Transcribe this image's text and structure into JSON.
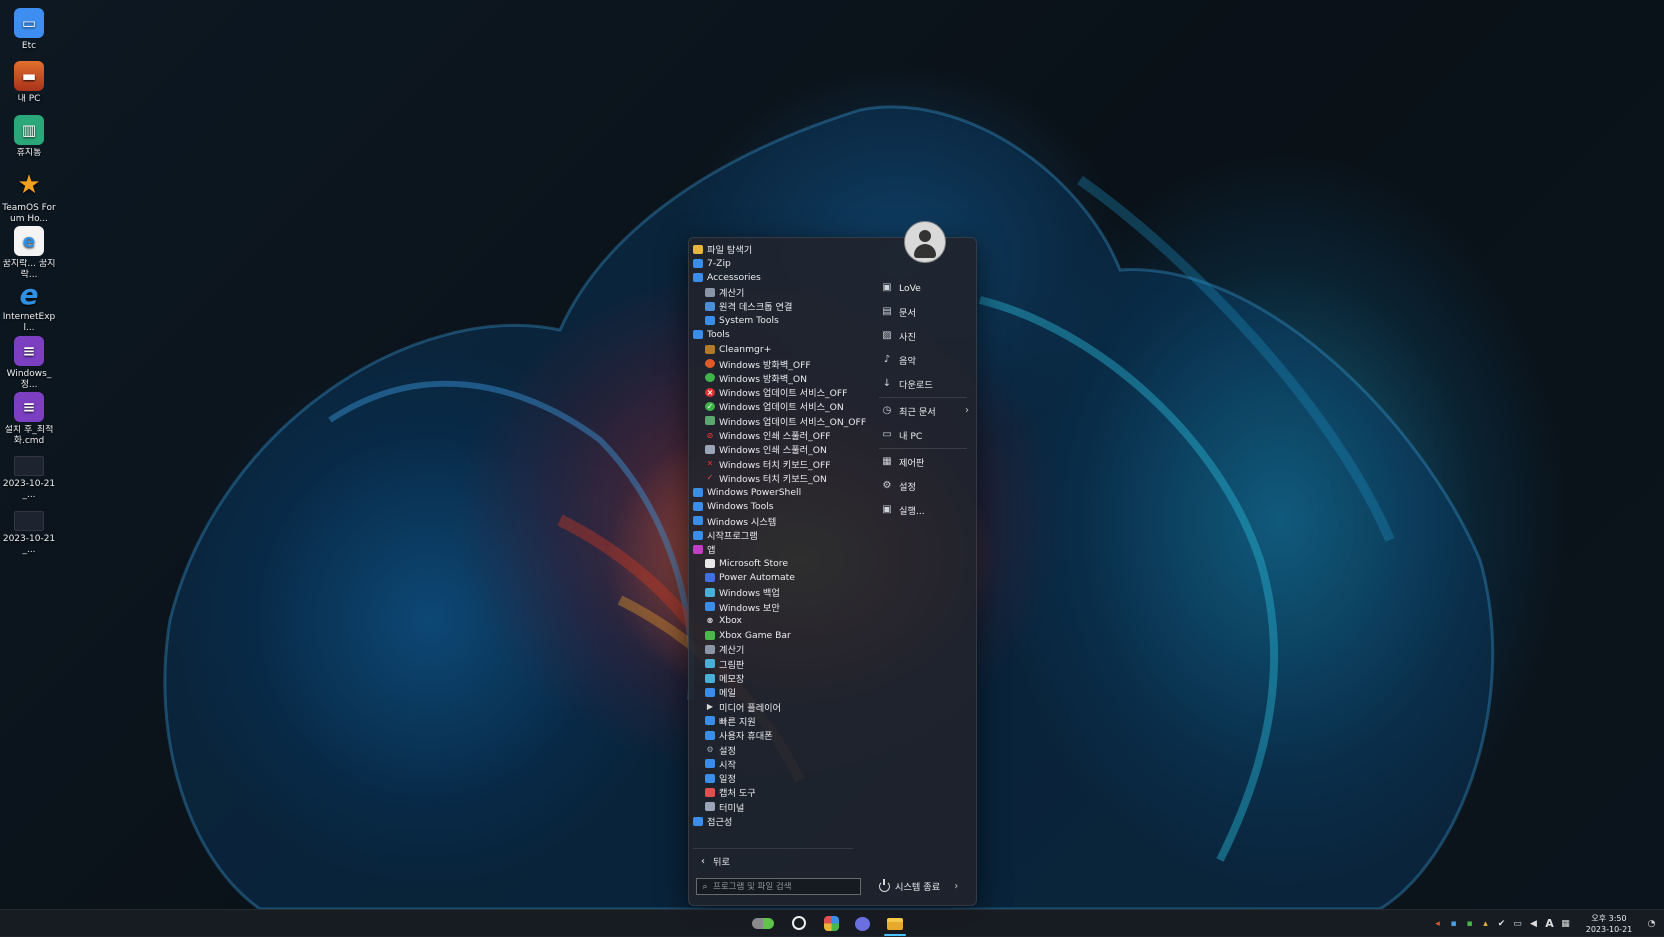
{
  "desktop": {
    "icons": [
      {
        "label": "Etc",
        "icon": "folder-icon",
        "color": "#3d8ef0"
      },
      {
        "label": "내 PC",
        "icon": "monitor-icon",
        "color": "#d85a2a"
      },
      {
        "label": "휴지통",
        "icon": "recycle-bin-icon",
        "color": "#2aa87a"
      },
      {
        "label": "TeamOS Forum Ho...",
        "icon": "star-icon",
        "color": "#e99a1f"
      },
      {
        "label": "꿈지락... 꿈지락...",
        "icon": "internet-explorer-icon",
        "color": "#2f8fe0"
      },
      {
        "label": "InternetExpl...",
        "icon": "internet-explorer-icon",
        "color": "#2f8fe0"
      },
      {
        "label": "Windows_정...",
        "icon": "script-icon",
        "color": "#7c3fc2"
      },
      {
        "label": "설치 후_최적화.cmd",
        "icon": "script-icon",
        "color": "#7c3fc2"
      },
      {
        "label": "2023-10-21_...",
        "icon": "screenshot-thumbnail-icon",
        "color": "#1d2430"
      },
      {
        "label": "2023-10-21_...",
        "icon": "screenshot-thumbnail-icon",
        "color": "#1d2430"
      }
    ]
  },
  "start_menu": {
    "programs": [
      {
        "label": "파일 탐색기",
        "level": 0,
        "icon": "file-explorer-icon",
        "color": "#e8b73a"
      },
      {
        "label": "7-Zip",
        "level": 0,
        "icon": "folder-icon",
        "color": "#3a8ee8"
      },
      {
        "label": "Accessories",
        "level": 0,
        "icon": "folder-icon",
        "color": "#3a8ee8"
      },
      {
        "label": "계산기",
        "level": 1,
        "icon": "calculator-icon",
        "color": "#8a96a6"
      },
      {
        "label": "원격 데스크톱 연결",
        "level": 1,
        "icon": "remote-desktop-icon",
        "color": "#4a8fd8"
      },
      {
        "label": "System Tools",
        "level": 1,
        "icon": "folder-icon",
        "color": "#3a8ee8"
      },
      {
        "label": "Tools",
        "level": 0,
        "icon": "folder-icon",
        "color": "#3a8ee8"
      },
      {
        "label": "Cleanmgr+",
        "level": 1,
        "icon": "cleanmgr-icon",
        "color": "#b07a2a"
      },
      {
        "label": "Windows 방화벽_OFF",
        "level": 1,
        "icon": "shield-off-icon",
        "color": "#e05a2a"
      },
      {
        "label": "Windows 방화벽_ON",
        "level": 1,
        "icon": "shield-on-icon",
        "color": "#3fb54a"
      },
      {
        "label": "Windows 업데이트 서비스_OFF",
        "level": 1,
        "icon": "close-circle-icon",
        "color": "#e03030"
      },
      {
        "label": "Windows 업데이트 서비스_ON",
        "level": 1,
        "icon": "check-circle-icon",
        "color": "#3fb54a"
      },
      {
        "label": "Windows 업데이트 서비스_ON_OFF",
        "level": 1,
        "icon": "toggle-icon",
        "color": "#5aa870"
      },
      {
        "label": "Windows 인쇄 스풀러_OFF",
        "level": 1,
        "icon": "no-entry-icon",
        "color": "#e03030"
      },
      {
        "label": "Windows 인쇄 스풀러_ON",
        "level": 1,
        "icon": "printer-icon",
        "color": "#9aa6b8"
      },
      {
        "label": "Windows 터치 키보드_OFF",
        "level": 1,
        "icon": "close-icon",
        "color": "#e03030"
      },
      {
        "label": "Windows 터치 키보드_ON",
        "level": 1,
        "icon": "check-icon",
        "color": "#e05050"
      },
      {
        "label": "Windows PowerShell",
        "level": 0,
        "icon": "folder-icon",
        "color": "#3a8ee8"
      },
      {
        "label": "Windows Tools",
        "level": 0,
        "icon": "folder-icon",
        "color": "#3a8ee8"
      },
      {
        "label": "Windows 시스템",
        "level": 0,
        "icon": "folder-icon",
        "color": "#3a8ee8"
      },
      {
        "label": "시작프로그램",
        "level": 0,
        "icon": "folder-icon",
        "color": "#3a8ee8"
      },
      {
        "label": "앱",
        "level": 0,
        "icon": "apps-folder-icon",
        "color": "#c03fc2"
      },
      {
        "label": "Microsoft Store",
        "level": 1,
        "icon": "store-icon",
        "color": "#e8e8e8"
      },
      {
        "label": "Power Automate",
        "level": 1,
        "icon": "power-automate-icon",
        "color": "#3f6fe0"
      },
      {
        "label": "Windows 백업",
        "level": 1,
        "icon": "backup-icon",
        "color": "#4ab0d8"
      },
      {
        "label": "Windows 보안",
        "level": 1,
        "icon": "security-shield-icon",
        "color": "#3a8ee8"
      },
      {
        "label": "Xbox",
        "level": 1,
        "icon": "xbox-icon",
        "color": "#e8e8e8"
      },
      {
        "label": "Xbox Game Bar",
        "level": 1,
        "icon": "game-bar-icon",
        "color": "#4ab84a"
      },
      {
        "label": "계산기",
        "level": 1,
        "icon": "calculator-icon",
        "color": "#8a96a6"
      },
      {
        "label": "그림판",
        "level": 1,
        "icon": "paint-icon",
        "color": "#4ab0d8"
      },
      {
        "label": "메모장",
        "level": 1,
        "icon": "notepad-icon",
        "color": "#4ab0d8"
      },
      {
        "label": "메일",
        "level": 1,
        "icon": "mail-icon",
        "color": "#3a8ee8"
      },
      {
        "label": "미디어 플레이어",
        "level": 1,
        "icon": "media-player-icon",
        "color": "#d8d8d8"
      },
      {
        "label": "빠른 지원",
        "level": 1,
        "icon": "quick-assist-icon",
        "color": "#3a8ee8"
      },
      {
        "label": "사용자 휴대폰",
        "level": 1,
        "icon": "phone-link-icon",
        "color": "#3a8ee8"
      },
      {
        "label": "설정",
        "level": 1,
        "icon": "settings-gear-icon",
        "color": "#9aa6b8"
      },
      {
        "label": "시작",
        "level": 1,
        "icon": "tips-icon",
        "color": "#3a8ee8"
      },
      {
        "label": "일정",
        "level": 1,
        "icon": "calendar-icon",
        "color": "#3a8ee8"
      },
      {
        "label": "캡처 도구",
        "level": 1,
        "icon": "snipping-tool-icon",
        "color": "#e05050"
      },
      {
        "label": "터미널",
        "level": 1,
        "icon": "terminal-icon",
        "color": "#9aa6b8"
      },
      {
        "label": "접근성",
        "level": 0,
        "icon": "folder-icon",
        "color": "#3a8ee8"
      }
    ],
    "places": [
      {
        "label": "LoVe",
        "icon": "user-folder-icon",
        "glyph": "▣",
        "arrow": false
      },
      {
        "label": "문서",
        "icon": "document-icon",
        "glyph": "▤",
        "arrow": false
      },
      {
        "label": "사진",
        "icon": "pictures-icon",
        "glyph": "▨",
        "arrow": false
      },
      {
        "label": "음악",
        "icon": "music-icon",
        "glyph": "♪",
        "arrow": false
      },
      {
        "label": "다운로드",
        "icon": "download-icon",
        "glyph": "↓",
        "arrow": false
      },
      {
        "label": "최근 문서",
        "icon": "recent-clock-icon",
        "glyph": "◷",
        "arrow": true
      },
      {
        "label": "내 PC",
        "icon": "computer-icon",
        "glyph": "▭",
        "arrow": false
      },
      {
        "label": "제어판",
        "icon": "control-panel-icon",
        "glyph": "▦",
        "arrow": false
      },
      {
        "label": "설정",
        "icon": "settings-icon",
        "glyph": "⚙",
        "arrow": false
      },
      {
        "label": "실행...",
        "icon": "run-icon",
        "glyph": "▣",
        "arrow": false
      }
    ],
    "back_label": "뒤로",
    "search_placeholder": "프로그램 및 파일 검색",
    "shutdown_label": "시스템 종료"
  },
  "taskbar": {
    "clock_time": "오후 3:50",
    "clock_date": "2023-10-21",
    "ime_label": "A",
    "accent": "#4cc2ff"
  }
}
